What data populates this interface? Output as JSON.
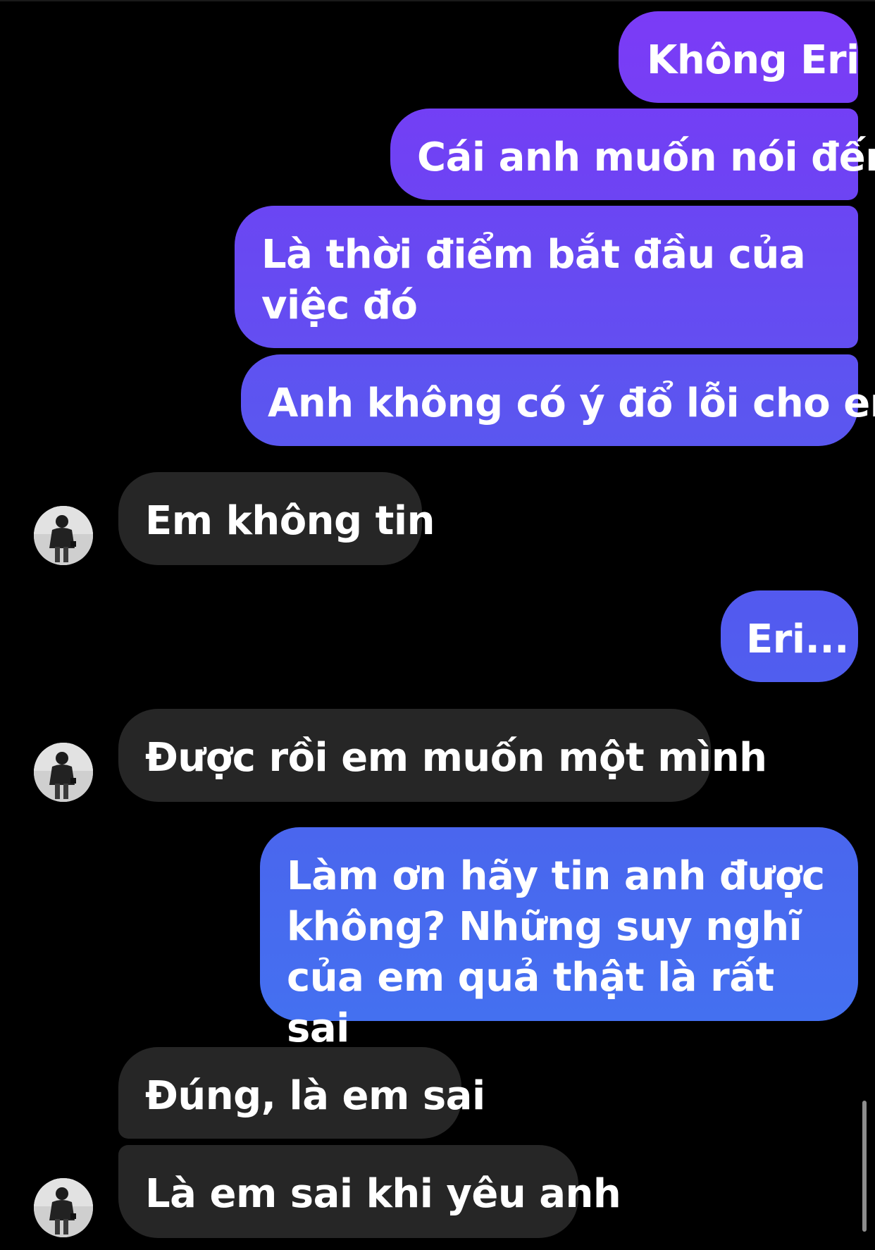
{
  "conversation": {
    "messages": [
      {
        "sender": "me",
        "text": "Không Eri"
      },
      {
        "sender": "me",
        "text": "Cái anh muốn nói đến"
      },
      {
        "sender": "me",
        "text": "Là thời điểm bắt đầu của việc đó"
      },
      {
        "sender": "me",
        "text": "Anh không có ý đổ lỗi cho em"
      },
      {
        "sender": "them",
        "text": "Em không tin"
      },
      {
        "sender": "me",
        "text": "Eri..."
      },
      {
        "sender": "them",
        "text": "Được rồi em muốn một mình"
      },
      {
        "sender": "me",
        "text": "Làm ơn hãy tin anh được không? Những suy nghĩ của em quả thật là rất sai"
      },
      {
        "sender": "them",
        "text": "Đúng, là em sai"
      },
      {
        "sender": "them",
        "text": "Là em sai khi yêu anh"
      }
    ]
  },
  "colors": {
    "background": "#000000",
    "incoming_bubble": "#262626",
    "outgoing_gradient": [
      "#7a3cf5",
      "#6a48f2",
      "#5a55f0",
      "#4d62ee",
      "#436ff0"
    ],
    "text": "#ffffff"
  },
  "icons": {
    "avatar": "contact-avatar-photo"
  }
}
